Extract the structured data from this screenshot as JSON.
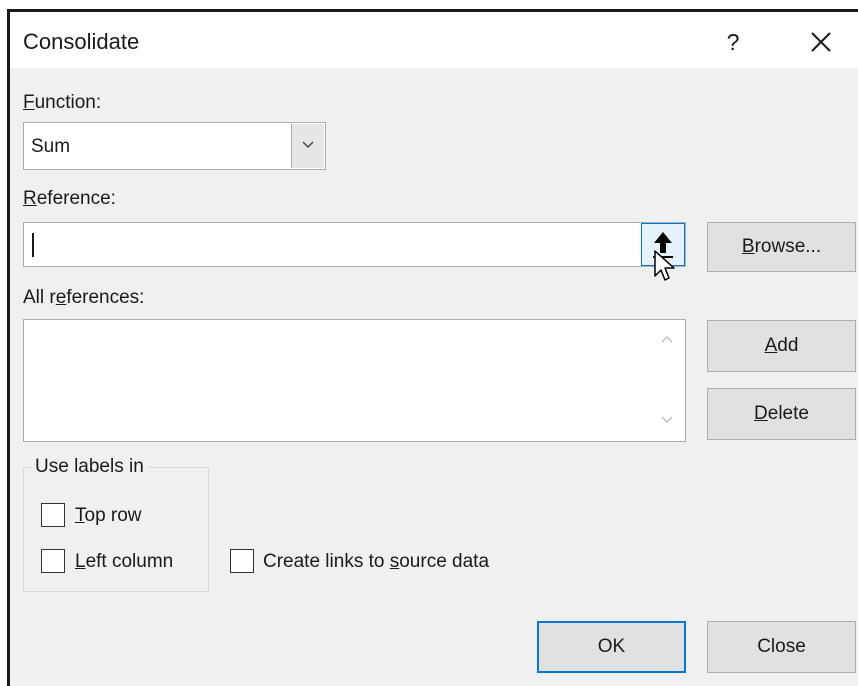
{
  "dialog": {
    "title": "Consolidate",
    "help_glyph": "?",
    "close_glyph": "✕"
  },
  "function": {
    "label": "Function:",
    "selected": "Sum"
  },
  "reference": {
    "label": "Reference:",
    "value": "",
    "collapse_icon": "up-arrow-icon"
  },
  "all_references": {
    "label": "All references:",
    "items": []
  },
  "buttons": {
    "browse": "Browse...",
    "add": "Add",
    "delete": "Delete",
    "ok": "OK",
    "close": "Close"
  },
  "use_labels": {
    "legend": "Use labels in",
    "top_row": {
      "label": "Top row",
      "checked": false
    },
    "left_column": {
      "label": "Left column",
      "checked": false
    }
  },
  "create_links": {
    "label": "Create links to source data",
    "checked": false
  },
  "colors": {
    "accent": "#0078d7",
    "dialog_bg": "#f0f0f0",
    "button_bg": "#e1e1e1"
  }
}
